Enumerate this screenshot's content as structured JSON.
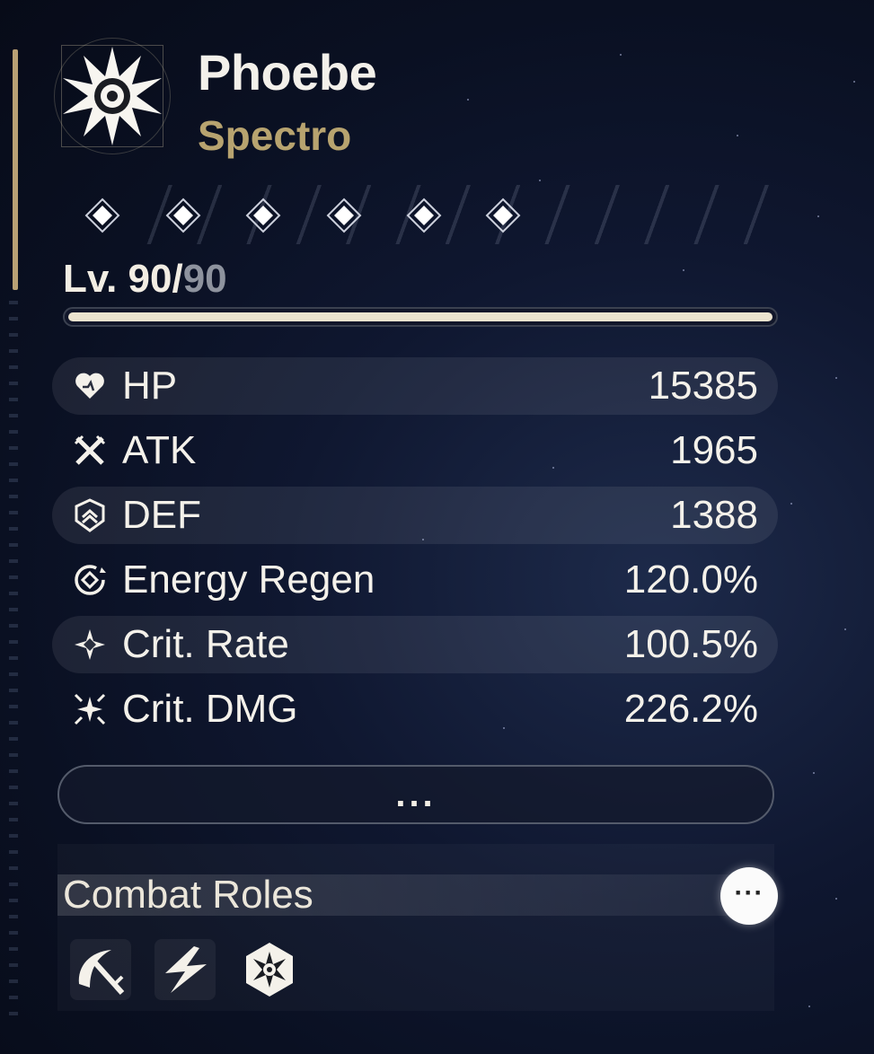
{
  "character": {
    "name": "Phoebe",
    "element": "Spectro",
    "element_icon": "spectro-icon",
    "element_color": "#b7a36f",
    "sequence_nodes": 6,
    "sequence_unlocked": 6
  },
  "level": {
    "current": "Lv. 90/",
    "max": "90",
    "progress": 1.0
  },
  "stats": [
    {
      "icon": "hp-icon",
      "label": "HP",
      "value": "15385"
    },
    {
      "icon": "atk-icon",
      "label": "ATK",
      "value": "1965"
    },
    {
      "icon": "def-icon",
      "label": "DEF",
      "value": "1388"
    },
    {
      "icon": "energy-regen-icon",
      "label": "Energy Regen",
      "value": "120.0%"
    },
    {
      "icon": "crit-rate-icon",
      "label": "Crit. Rate",
      "value": "100.5%"
    },
    {
      "icon": "crit-dmg-icon",
      "label": "Crit. DMG",
      "value": "226.2%"
    }
  ],
  "more_button": {
    "label": "..."
  },
  "combat_roles": {
    "title": "Combat Roles",
    "more_label": "···",
    "roles": [
      "scythe-sword-icon",
      "lightning-slash-icon",
      "spectro-hexagon-icon"
    ]
  }
}
